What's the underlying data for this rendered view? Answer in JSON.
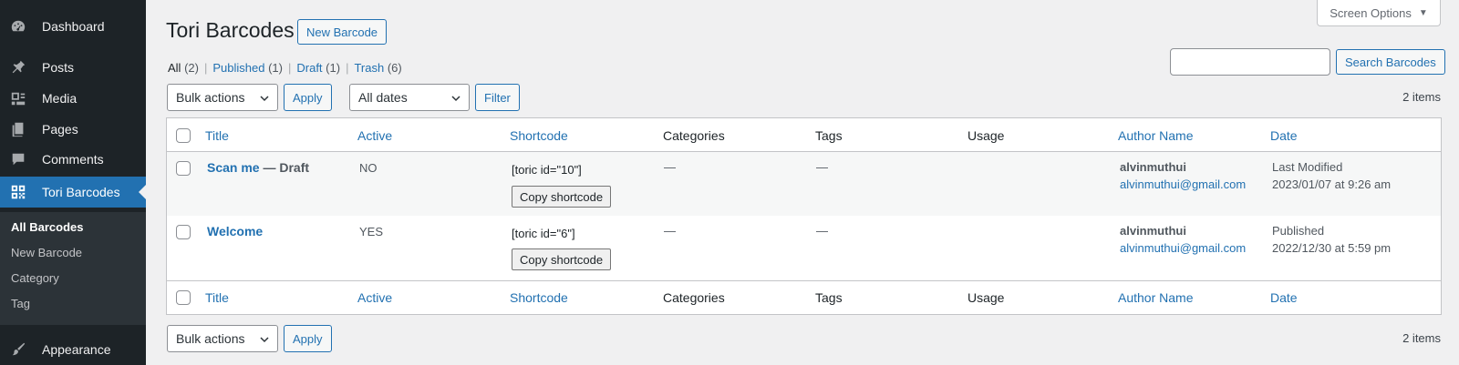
{
  "sidebar": {
    "items": [
      {
        "label": "Dashboard",
        "icon": "dashboard-icon"
      },
      {
        "label": "Posts",
        "icon": "pin-icon"
      },
      {
        "label": "Media",
        "icon": "media-icon"
      },
      {
        "label": "Pages",
        "icon": "pages-icon"
      },
      {
        "label": "Comments",
        "icon": "comment-icon"
      },
      {
        "label": "Tori Barcodes",
        "icon": "qr-code-icon"
      },
      {
        "label": "Appearance",
        "icon": "brush-icon"
      }
    ],
    "submenu": [
      "All Barcodes",
      "New Barcode",
      "Category",
      "Tag"
    ]
  },
  "header": {
    "title": "Tori Barcodes",
    "new_button": "New Barcode",
    "screen_options": "Screen Options"
  },
  "filters": {
    "views": [
      {
        "label": "All",
        "count": "(2)"
      },
      {
        "label": "Published",
        "count": "(1)"
      },
      {
        "label": "Draft",
        "count": "(1)"
      },
      {
        "label": "Trash",
        "count": "(6)"
      }
    ],
    "search_button": "Search Barcodes",
    "search_value": "",
    "bulk_actions": "Bulk actions",
    "apply": "Apply",
    "dates": "All dates",
    "filter": "Filter",
    "items_count": "2 items"
  },
  "table": {
    "columns": [
      "Title",
      "Active",
      "Shortcode",
      "Categories",
      "Tags",
      "Usage",
      "Author Name",
      "Date"
    ],
    "rows": [
      {
        "title": "Scan me",
        "state": " — Draft",
        "active": "NO",
        "shortcode": "[toric id=\"10\"]",
        "copy": "Copy shortcode",
        "categories": "—",
        "tags": "—",
        "author": "alvinmuthui",
        "email": "alvinmuthui@gmail.com",
        "date_status": "Last Modified",
        "date": "2023/01/07 at 9:26 am"
      },
      {
        "title": "Welcome",
        "state": "",
        "active": "YES",
        "shortcode": "[toric id=\"6\"]",
        "copy": "Copy shortcode",
        "categories": "—",
        "tags": "—",
        "author": "alvinmuthui",
        "email": "alvinmuthui@gmail.com",
        "date_status": "Published",
        "date": "2022/12/30 at 5:59 pm"
      }
    ]
  },
  "colors": {
    "accent": "#2271b1",
    "sidebar_bg": "#1d2327",
    "submenu_bg": "#2c3338",
    "page_bg": "#f0f0f1"
  }
}
